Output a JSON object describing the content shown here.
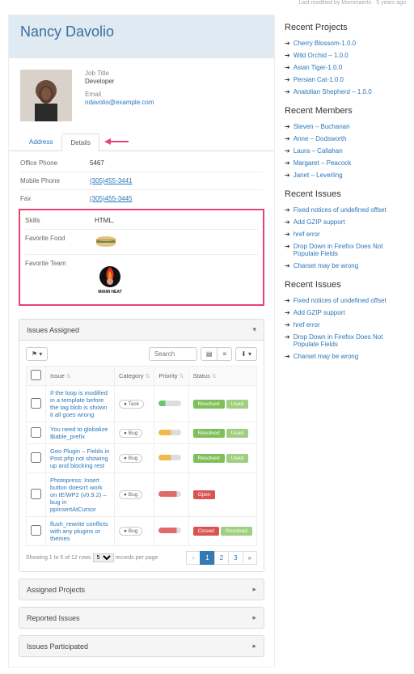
{
  "last_modified": "Last modified by Mommaerts · 5 years ago",
  "title": "Nancy Davolio",
  "profile": {
    "job_title_label": "Job Title",
    "job_title": "Developer",
    "email_label": "Email",
    "email": "ndavolio@example.com"
  },
  "tabs": {
    "address": "Address",
    "details": "Details"
  },
  "details": {
    "office_phone_k": "Office Phone",
    "office_phone_v": "5467",
    "mobile_phone_k": "Mobile Phone",
    "mobile_phone_v": "(305)455-3441",
    "fax_k": "Fax",
    "fax_v": "(305)455-3445",
    "skills_k": "Skills",
    "skills_v": "HTML,",
    "food_k": "Favorite Food",
    "team_k": "Favorite Team"
  },
  "panel_titles": {
    "issues_assigned": "Issues Assigned",
    "assigned_projects": "Assigned Projects",
    "reported_issues": "Reported Issues",
    "issues_participated": "Issues Participated"
  },
  "toolbar": {
    "search_placeholder": "Search"
  },
  "table": {
    "cols": {
      "issue": "Issue",
      "category": "Category",
      "priority": "Priority",
      "status": "Status"
    },
    "rows": [
      {
        "issue": "If the loop is modified in a template before the tag blob is shown it all goes wrong",
        "category": "Task",
        "priority": "low",
        "status": "Resolved",
        "status_cls": "resolved",
        "used": true
      },
      {
        "issue": "You need to globalize $table_prefix",
        "category": "Bug",
        "priority": "med",
        "status": "Resolved",
        "status_cls": "resolved",
        "used": true
      },
      {
        "issue": "Geo Plugin – Fields in Post.php not showing up and blocking rest",
        "category": "Bug",
        "priority": "med",
        "status": "Resolved",
        "status_cls": "resolved",
        "used": true
      },
      {
        "issue": "Photopress: Insert button doesn't work on IE/WP2 (v0.9.2) – bug in ppInsertAtCursor",
        "category": "Bug",
        "priority": "high",
        "status": "Open",
        "status_cls": "open",
        "used": false
      },
      {
        "issue": "flush_rewrite conflicts with any plugins or themes",
        "category": "Bug",
        "priority": "high",
        "status": "Closed",
        "status_cls": "closed",
        "used": false,
        "extra": "Resolved"
      }
    ],
    "footer": "Showing 1 to 5 of 12 rows",
    "per_page": "5",
    "per_page_suffix": "records per page"
  },
  "pager": [
    "«",
    "1",
    "2",
    "3",
    "»"
  ],
  "sidebar": {
    "recent_projects": {
      "title": "Recent Projects",
      "items": [
        "Cherry Blossom-1.0.0",
        "Wild Orchid – 1.0.0",
        "Asian Tiger-1.0.0",
        "Persian Cat-1.0.0",
        "Anatolian Shepherd – 1.0.0"
      ]
    },
    "recent_members": {
      "title": "Recent Members",
      "items": [
        "Steven – Buchanan",
        "Anne – Dodsworth",
        "Laura – Callahan",
        "Margaret – Peacock",
        "Janet – Leverling"
      ]
    },
    "recent_issues1": {
      "title": "Recent Issues",
      "items": [
        "Fixed notices of undefined offset",
        "Add GZIP support",
        "href error",
        "Drop Down in Firefox Does Not Populate Fields",
        "Charset may be wrong"
      ]
    },
    "recent_issues2": {
      "title": "Recent Issues",
      "items": [
        "Fixed notices of undefined offset",
        "Add GZIP support",
        "href error",
        "Drop Down in Firefox Does Not Populate Fields",
        "Charset may be wrong"
      ]
    }
  }
}
